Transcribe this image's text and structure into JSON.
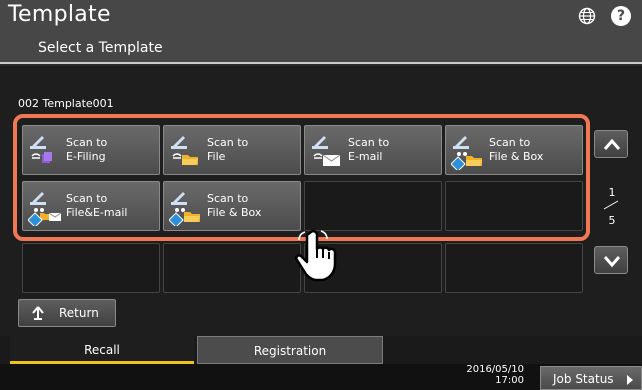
{
  "header": {
    "title": "Template",
    "subtitle": "Select a Template",
    "icons": [
      "globe-icon",
      "help-icon"
    ],
    "help_glyph": "?"
  },
  "template_group": "002 Template001",
  "templates": [
    {
      "label": "Scan to\nE-Filing",
      "icon": "scan-to-efiling-icon"
    },
    {
      "label": "Scan to\nFile",
      "icon": "scan-to-file-icon"
    },
    {
      "label": "Scan to\nE-mail",
      "icon": "scan-to-email-icon"
    },
    {
      "label": "Scan to\nFile & Box",
      "icon": "scan-to-file-box-icon"
    },
    {
      "label": "Scan to\nFile&E-mail",
      "icon": "scan-to-file-email-icon"
    },
    {
      "label": "Scan to\nFile & Box",
      "icon": "scan-to-file-box-icon"
    }
  ],
  "pagination": {
    "current": "1",
    "total": "5"
  },
  "return_label": "Return",
  "tabs": {
    "recall": "Recall",
    "registration": "Registration"
  },
  "footer": {
    "date": "2016/05/10",
    "time": "17:00",
    "job_status": "Job Status"
  },
  "colors": {
    "highlight": "#f07855",
    "active_tab": "#f1c21b",
    "title_bar": "#474747"
  }
}
